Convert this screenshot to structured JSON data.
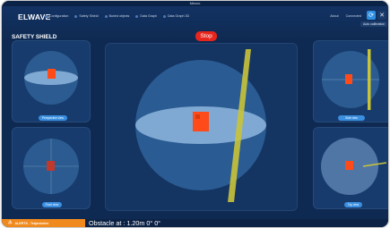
{
  "window": {
    "title": "Mezzo"
  },
  "header": {
    "brand": "ELWAVE",
    "nav": [
      {
        "label": "Configuration"
      },
      {
        "label": "Safety Shield"
      },
      {
        "label": "Buried objects"
      },
      {
        "label": "Data Graph"
      },
      {
        "label": "Data Graph 3D"
      }
    ],
    "right": {
      "about": "About",
      "user": "Connected"
    },
    "tooltip": "Auto calibration"
  },
  "page": {
    "title": "SAFETY SHIELD",
    "stop_label": "Stop"
  },
  "views": {
    "top_left": {
      "button": "Perspective view"
    },
    "bottom_left": {
      "button": "Front view"
    },
    "center": {},
    "top_right": {
      "button": "Side view"
    },
    "bottom_right": {
      "button": "Top view"
    }
  },
  "status": {
    "alert_label": "ALERTS - Trajectories",
    "obstacle_text": "Obstacle at : 1.20m 0° 0°"
  },
  "colors": {
    "background": "#0f2a52",
    "panel": "#173b6d",
    "stop": "#e8251c",
    "alert": "#f08a1e",
    "object": "#ff4a1a",
    "pole": "#c9c33a"
  }
}
